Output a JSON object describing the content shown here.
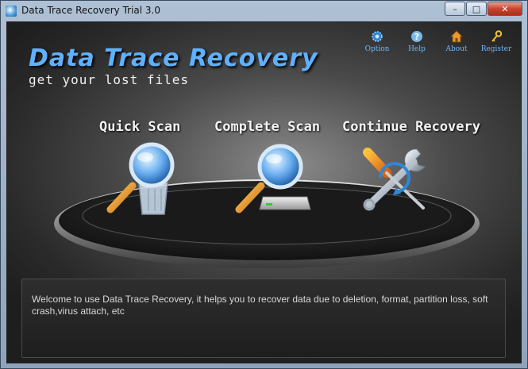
{
  "window": {
    "title": "Data Trace Recovery Trial 3.0",
    "minimize_glyph": "–",
    "maximize_glyph": "□",
    "close_glyph": "✕"
  },
  "logo": {
    "title": "Data Trace Recovery",
    "subtitle": "get your lost files"
  },
  "topnav": {
    "items": [
      {
        "label": "Option",
        "icon": "gear-icon"
      },
      {
        "label": "Help",
        "icon": "help-icon"
      },
      {
        "label": "About",
        "icon": "home-icon"
      },
      {
        "label": "Register",
        "icon": "key-icon"
      }
    ]
  },
  "actions": {
    "quick_scan": {
      "label": "Quick Scan",
      "icon": "magnifier-recycle-bin-icon"
    },
    "complete_scan": {
      "label": "Complete Scan",
      "icon": "magnifier-hard-drive-icon"
    },
    "continue_recovery": {
      "label": "Continue Recovery",
      "icon": "wrench-screwdriver-icon"
    }
  },
  "message": "Welcome to use Data Trace Recovery, it helps you to recover data due to deletion, format, partition loss, soft crash,virus attach, etc",
  "colors": {
    "accent_blue": "#5fb1ff",
    "nav_text": "#6fb8ff",
    "background_dark": "#2a2a2a"
  }
}
